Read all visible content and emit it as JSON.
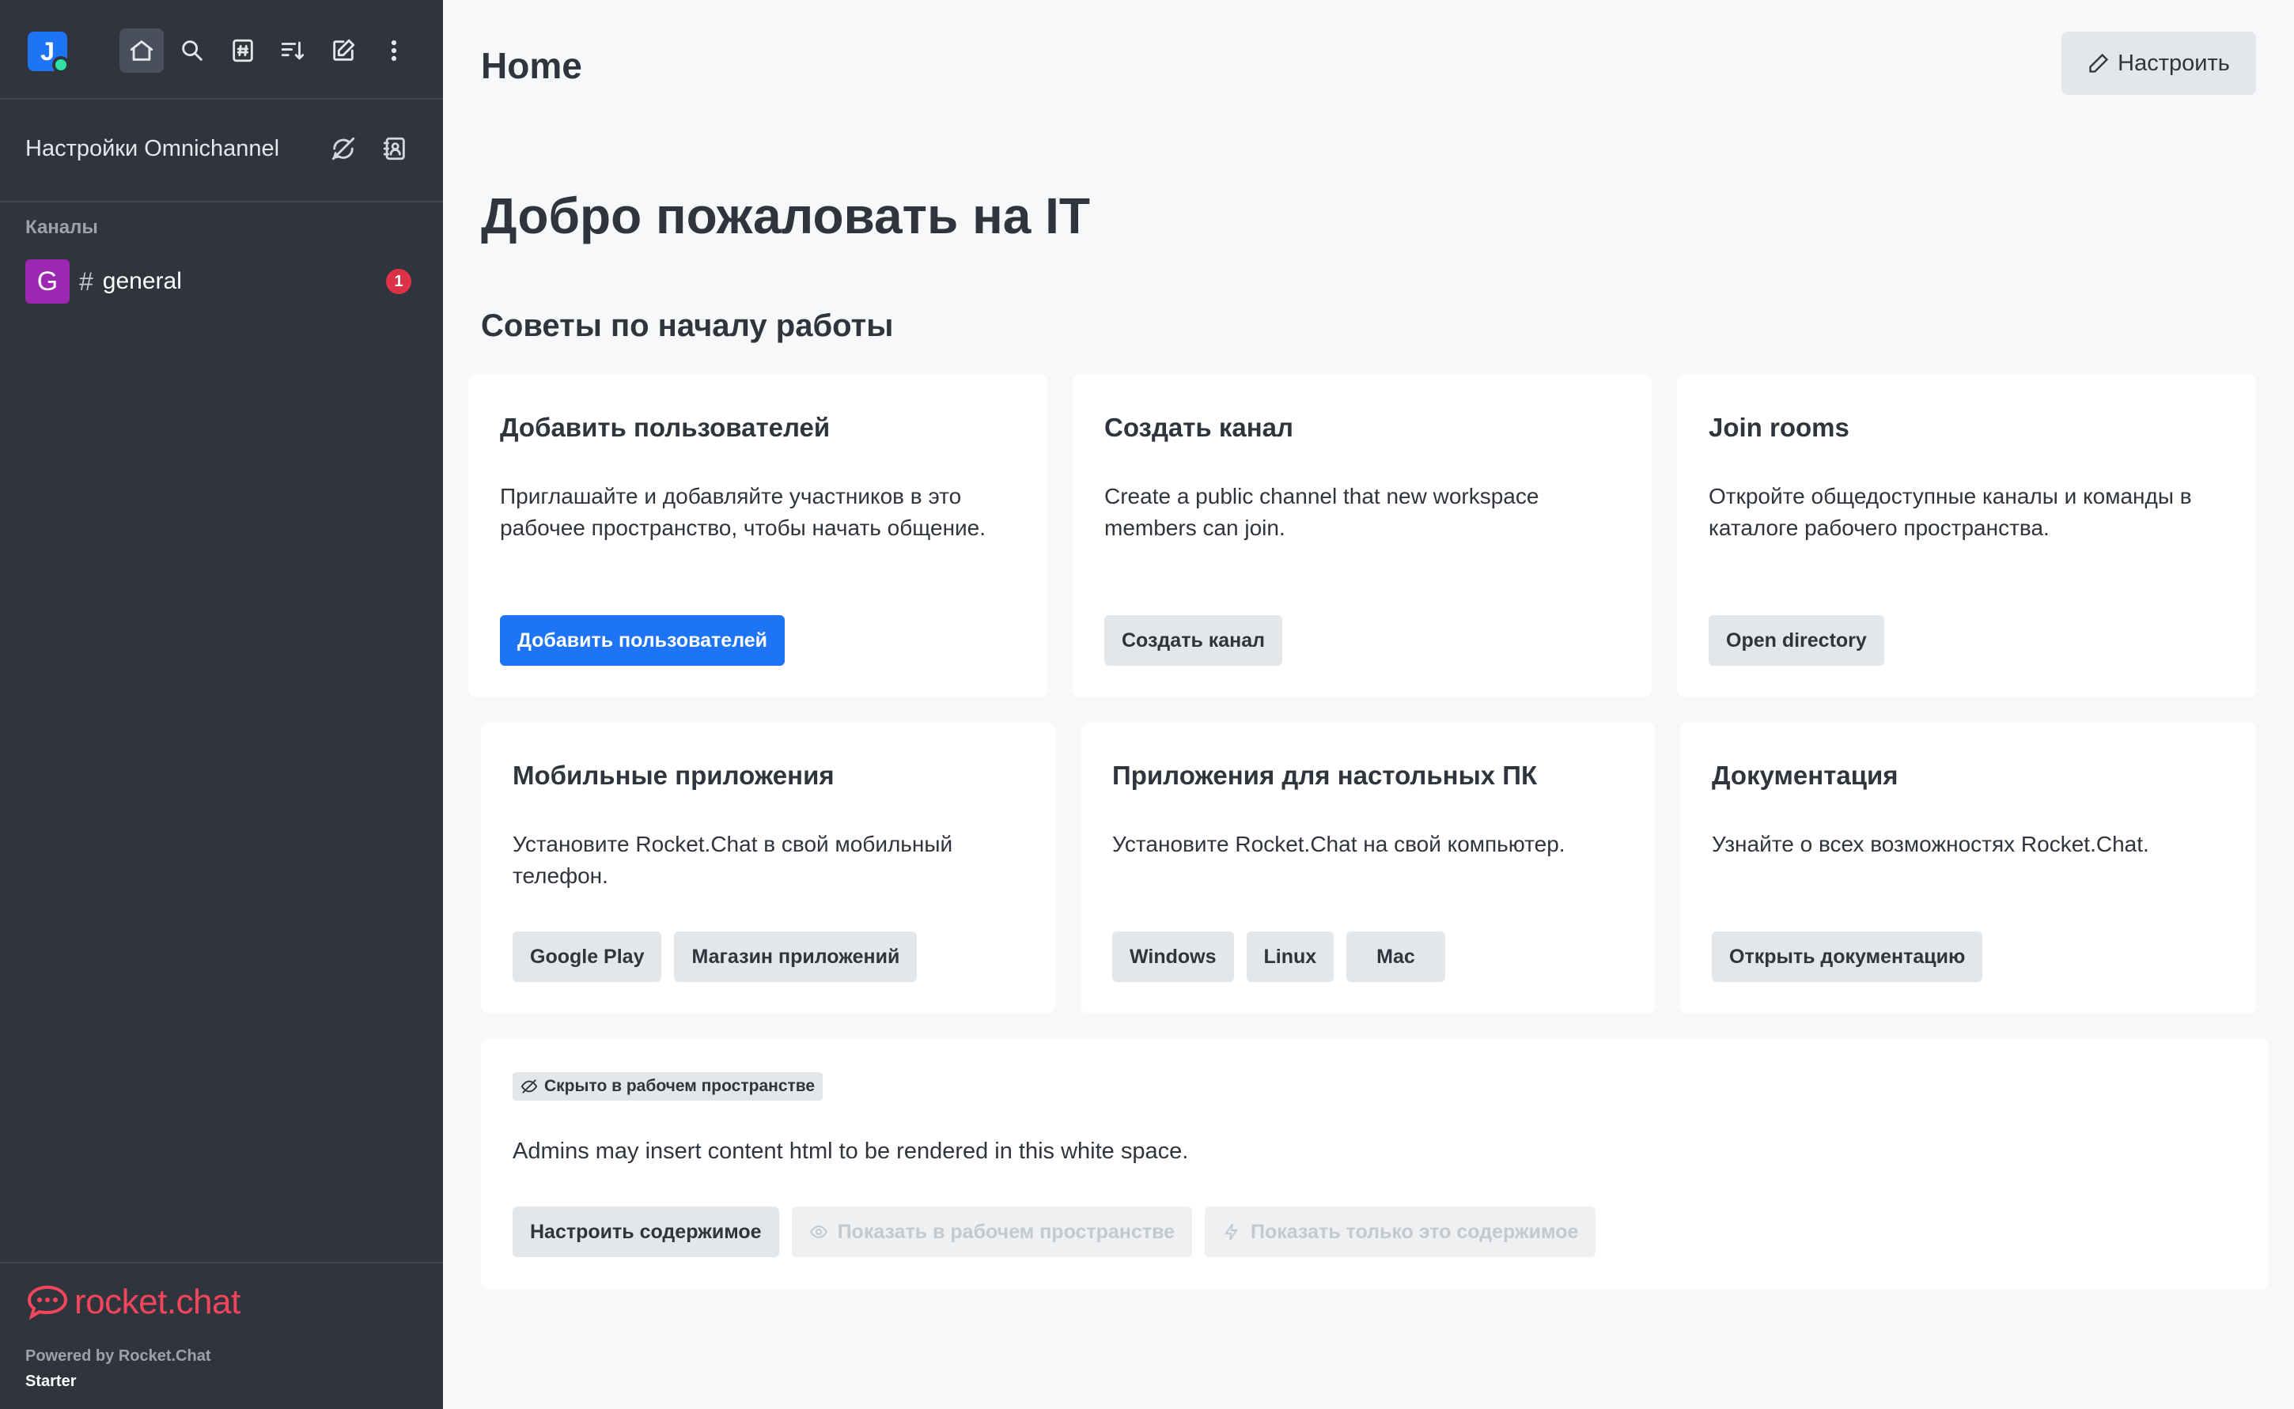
{
  "user": {
    "avatar_letter": "J",
    "status": "online"
  },
  "sidebar": {
    "omnichannel_label": "Настройки Omnichannel",
    "channels_label": "Каналы",
    "channels": [
      {
        "avatar_letter": "G",
        "name": "general",
        "unread": "1"
      }
    ],
    "footer": {
      "logo_text": "rocket.chat",
      "powered_by": "Powered by Rocket.Chat",
      "plan": "Starter"
    }
  },
  "header": {
    "title": "Home",
    "customize_label": "Настроить"
  },
  "welcome": "Добро пожаловать на IT",
  "tips_heading": "Советы по началу работы",
  "cards": {
    "add_users": {
      "title": "Добавить пользователей",
      "body": "Приглашайте и добавляйте участников в это рабочее пространство, чтобы начать общение.",
      "button": "Добавить пользователей"
    },
    "create_channel": {
      "title": "Создать канал",
      "body": "Create a public channel that new workspace members can join.",
      "button": "Создать канал"
    },
    "join_rooms": {
      "title": "Join rooms",
      "body": "Откройте общедоступные каналы и команды в каталоге рабочего пространства.",
      "button": "Open directory"
    },
    "mobile": {
      "title": "Мобильные приложения",
      "body": "Установите Rocket.Chat в свой мобильный телефон.",
      "buttons": [
        "Google Play",
        "Магазин приложений"
      ]
    },
    "desktop": {
      "title": "Приложения для настольных ПК",
      "body": "Установите Rocket.Chat на свой компьютер.",
      "buttons": [
        "Windows",
        "Linux",
        "Mac"
      ]
    },
    "docs": {
      "title": "Документация",
      "body": "Узнайте о всех возможностях Rocket.Chat.",
      "button": "Открыть документацию"
    }
  },
  "custom_content": {
    "hidden_tag": "Скрыто в рабочем пространстве",
    "text": "Admins may insert content html to be rendered in this white space.",
    "buttons": {
      "customize": "Настроить содержимое",
      "show_workspace": "Показать в рабочем пространстве",
      "show_only": "Показать только это содержимое"
    }
  },
  "colors": {
    "sidebar_bg": "#2f343d",
    "primary": "#1d74f5",
    "badge": "#db3246",
    "brand": "#f5455c",
    "channel_avatar": "#9c27b0"
  }
}
